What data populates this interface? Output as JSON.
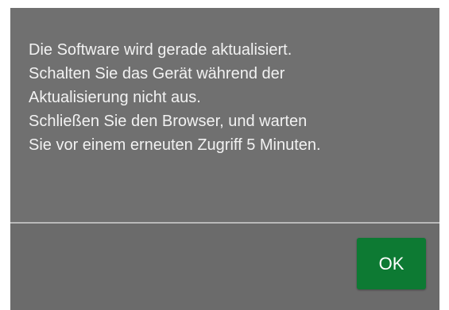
{
  "dialog": {
    "message_lines": [
      "Die Software wird gerade aktualisiert.",
      "Schalten Sie das Gerät während der",
      "Aktualisierung nicht aus.",
      "Schließen Sie den Browser, und warten",
      "Sie vor einem erneuten Zugriff 5 Minuten."
    ],
    "ok_label": "OK"
  },
  "colors": {
    "dialog_background": "#707070",
    "footer_background": "#6b6b6b",
    "divider": "#b9b9b9",
    "ok_button": "#0d7a33",
    "text": "#f2f2f2"
  }
}
